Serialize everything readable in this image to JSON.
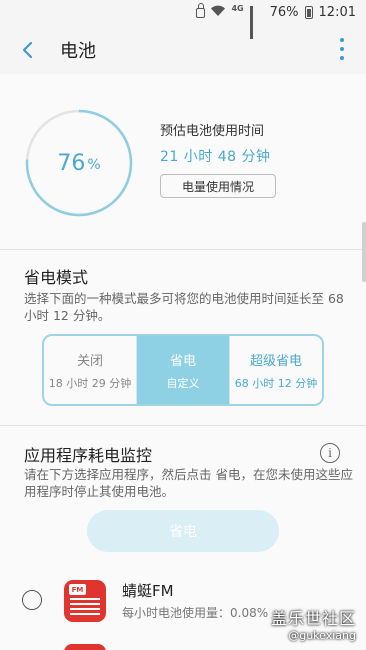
{
  "status_bar": {
    "network": "4G",
    "battery_percent": "76%",
    "time": "12:01",
    "icons": [
      "lock-icon",
      "wifi-icon",
      "signal-icon",
      "battery-icon"
    ]
  },
  "app_bar": {
    "title": "电池",
    "back_icon": "back-arrow-icon",
    "menu_icon": "more-vertical-icon"
  },
  "battery": {
    "level": 76,
    "level_number": "76",
    "level_symbol": "%",
    "estimate_label": "预估电池使用时间",
    "estimate_value": "21 小时 48 分钟",
    "usage_button": "电量使用情况",
    "accent_color": "#4aa9cf"
  },
  "power_saving": {
    "title": "省电模式",
    "description": "选择下面的一种模式最多可将您的电池使用时间延长至 68 小时 12 分钟。",
    "modes": [
      {
        "label": "关闭",
        "sub": "18 小时 29 分钟",
        "selected": false
      },
      {
        "label": "省电",
        "sub": "自定义",
        "selected": true
      },
      {
        "label": "超级省电",
        "sub": "68 小时 12 分钟",
        "selected": false
      }
    ]
  },
  "app_monitor": {
    "title": "应用程序耗电监控",
    "info_icon": "info-icon",
    "description": "请在下方选择应用程序，然后点击 省电，在您未使用这些应用程序时停止其使用电池。",
    "save_button": "省电",
    "apps": [
      {
        "name": "蜻蜓FM",
        "usage": "每小时电池使用量：0.08%",
        "icon_label": "FM",
        "checked": false
      }
    ]
  },
  "watermark": {
    "line1": "盖乐世社区",
    "line2": "@gukexiang"
  }
}
